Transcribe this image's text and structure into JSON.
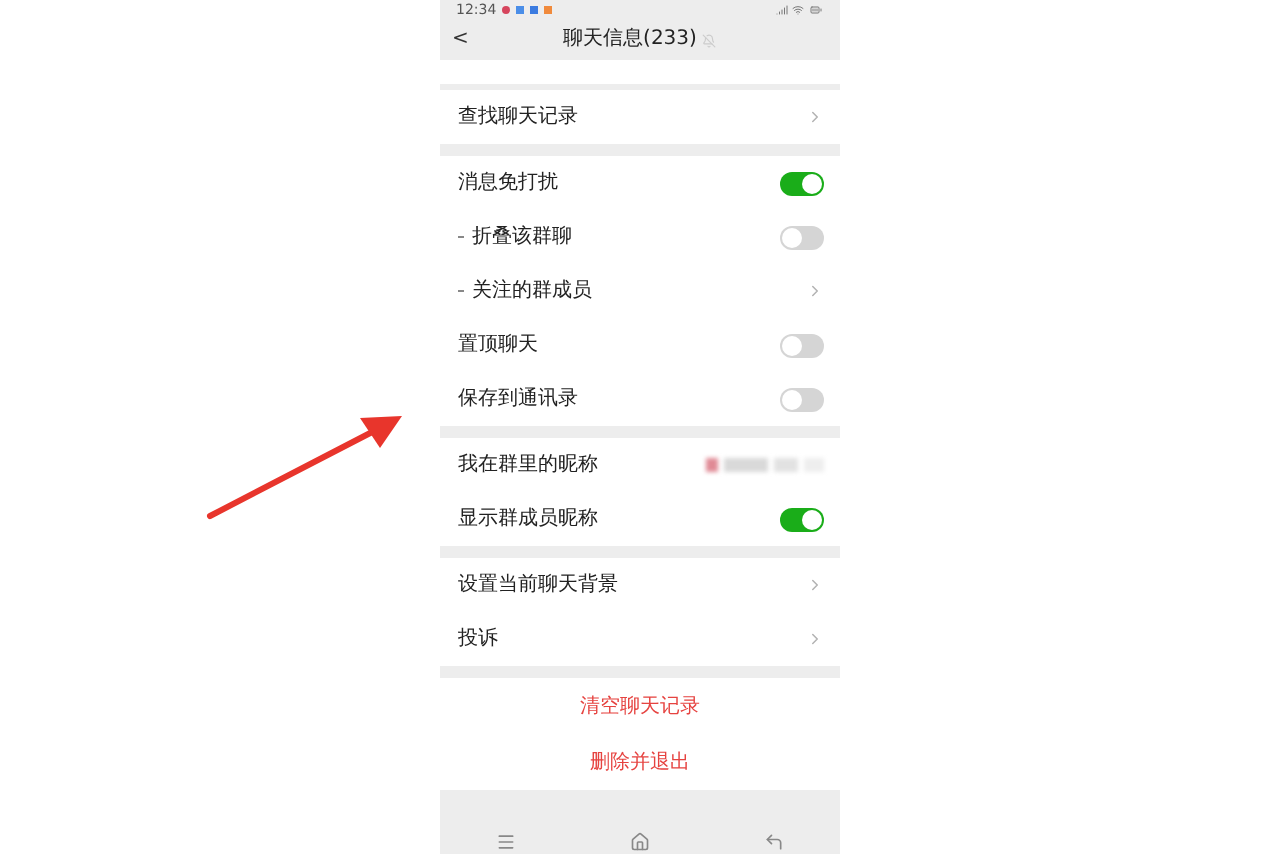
{
  "status_bar": {
    "time": "12:34"
  },
  "header": {
    "back": "<",
    "title": "聊天信息(233)",
    "muted": true
  },
  "groups": [
    {
      "rows": [
        {
          "kind": "link",
          "label": "查找聊天记录",
          "sub": false
        }
      ]
    },
    {
      "rows": [
        {
          "kind": "switch",
          "label": "消息免打扰",
          "sub": false,
          "on": true
        },
        {
          "kind": "switch",
          "label": "折叠该群聊",
          "sub": true,
          "on": false
        },
        {
          "kind": "link",
          "label": "关注的群成员",
          "sub": true
        },
        {
          "kind": "switch",
          "label": "置顶聊天",
          "sub": false,
          "on": false
        },
        {
          "kind": "switch",
          "label": "保存到通讯录",
          "sub": false,
          "on": false
        }
      ]
    },
    {
      "rows": [
        {
          "kind": "blurred",
          "label": "我在群里的昵称",
          "sub": false
        },
        {
          "kind": "switch",
          "label": "显示群成员昵称",
          "sub": false,
          "on": true
        }
      ]
    },
    {
      "rows": [
        {
          "kind": "link",
          "label": "设置当前聊天背景",
          "sub": false
        },
        {
          "kind": "link",
          "label": "投诉",
          "sub": false
        }
      ]
    }
  ],
  "actions": [
    "清空聊天记录",
    "删除并退出"
  ]
}
